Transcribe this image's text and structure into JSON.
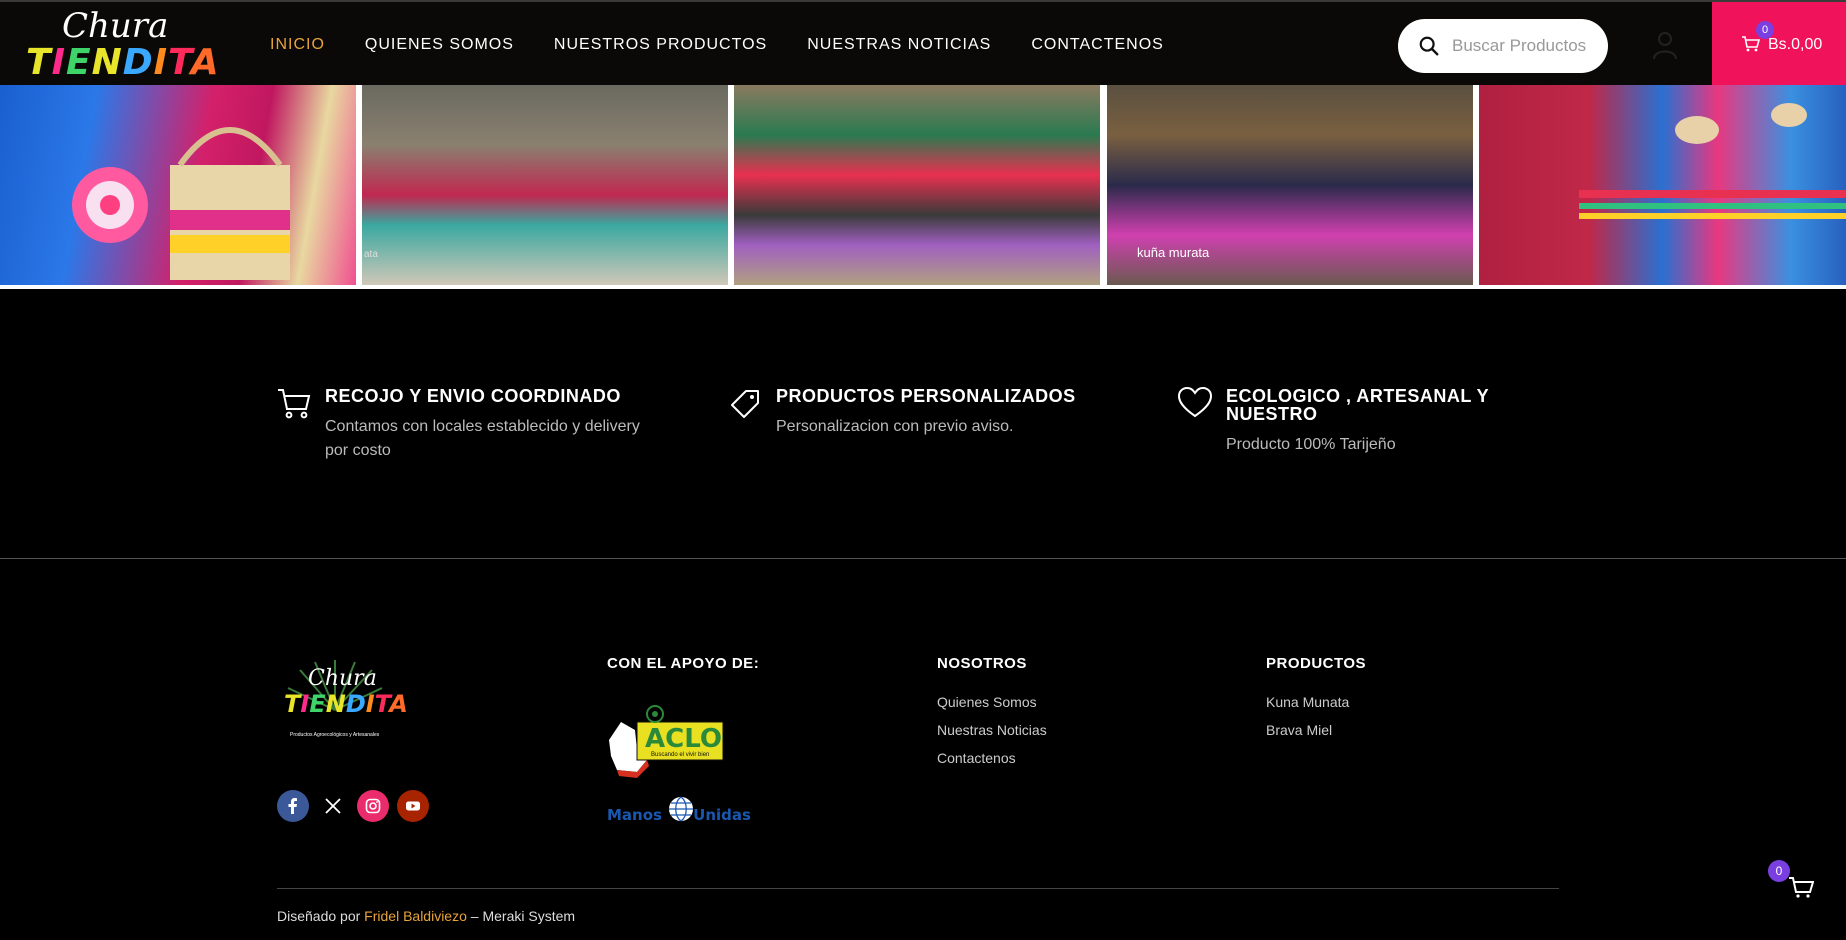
{
  "header": {
    "logo_script": "Chura",
    "logo_word": "TIENDITA",
    "nav": [
      {
        "label": "INICIO"
      },
      {
        "label": "QUIENES SOMOS"
      },
      {
        "label": "NUESTROS PRODUCTOS"
      },
      {
        "label": "NUESTRAS NOTICIAS"
      },
      {
        "label": "CONTACTENOS"
      }
    ],
    "search_placeholder": "Buscar Productos",
    "cart_count": "0",
    "cart_total": "Bs.0,00"
  },
  "photos": [
    {
      "label": ""
    },
    {
      "label": "ata"
    },
    {
      "label": ""
    },
    {
      "label": "kuña murata"
    },
    {
      "label": ""
    }
  ],
  "features": [
    {
      "title": "RECOJO Y ENVIO COORDINADO",
      "desc": "Contamos con locales establecido y delivery por costo",
      "icon": "cart-icon"
    },
    {
      "title": "PRODUCTOS PERSONALIZADOS",
      "desc": "Personalizacion con previo aviso.",
      "icon": "tag-icon"
    },
    {
      "title": "ECOLOGICO , ARTESANAL Y NUESTRO",
      "desc": "Producto 100% Tarijeño",
      "icon": "heart-icon"
    }
  ],
  "footer": {
    "logo_script": "Chura",
    "logo_word": "TIENDITA",
    "logo_tagline": "Productos Agroecológicos y Artesanales",
    "support_title": "CON EL APOYO DE:",
    "aclo_label": "ACLO",
    "aclo_tagline": "Buscando el vivir bien",
    "manos_label": "Manos Unidas",
    "nosotros_title": "NOSOTROS",
    "nosotros_links": [
      {
        "label": "Quienes Somos"
      },
      {
        "label": "Nuestras Noticias"
      },
      {
        "label": "Contactenos"
      }
    ],
    "productos_title": "PRODUCTOS",
    "productos_links": [
      {
        "label": "Kuna Munata"
      },
      {
        "label": "Brava Miel"
      }
    ],
    "credit_prefix": "Diseñado por ",
    "credit_author": "Fridel Baldiviezo",
    "credit_suffix": " – Meraki System",
    "float_cart_count": "0"
  },
  "colors": {
    "accent": "#e8a33b",
    "cart_bg": "#f0125a",
    "badge": "#7a3fe0"
  }
}
